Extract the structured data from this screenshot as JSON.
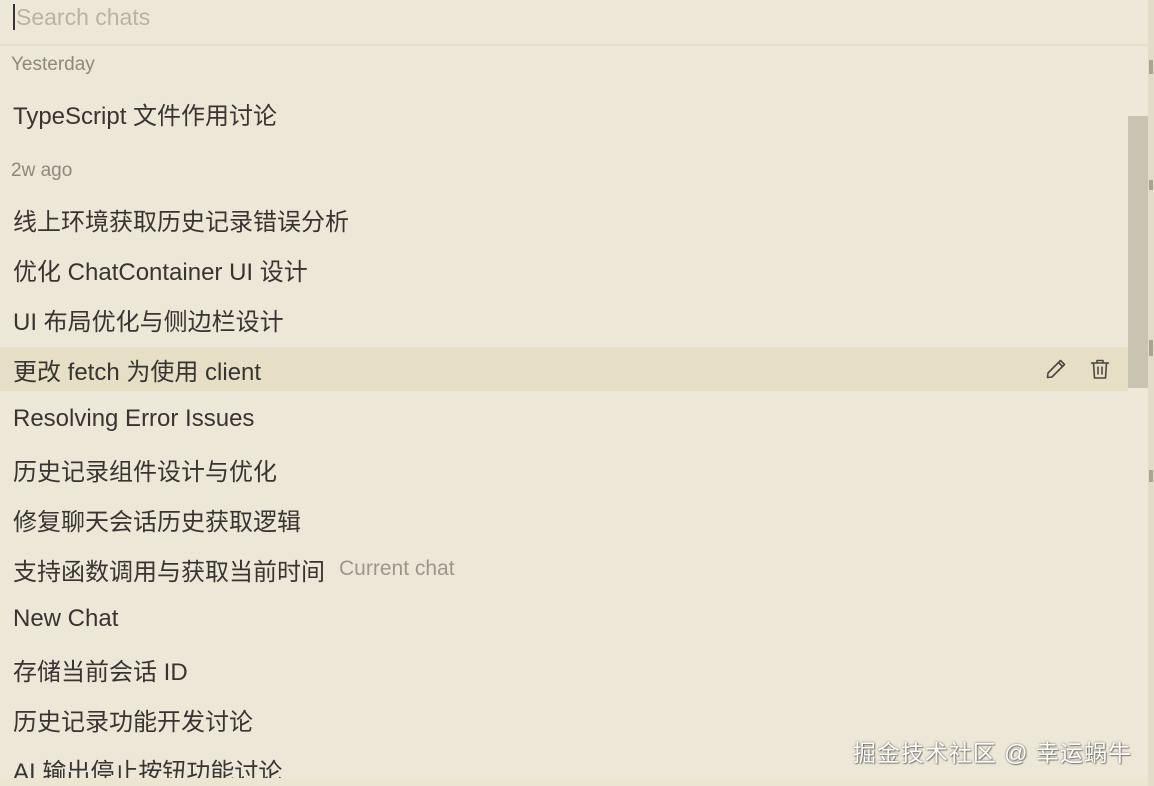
{
  "search": {
    "placeholder": "Search chats",
    "value": ""
  },
  "groups": [
    {
      "label": "Yesterday",
      "items": [
        {
          "title": "TypeScript 文件作用讨论"
        }
      ]
    },
    {
      "label": "2w ago",
      "items": [
        {
          "title": "线上环境获取历史记录错误分析"
        },
        {
          "title": "优化 ChatContainer UI 设计"
        },
        {
          "title": "UI 布局优化与侧边栏设计"
        },
        {
          "title": "更改 fetch 为使用 client",
          "hovered": true
        },
        {
          "title": "Resolving Error Issues"
        },
        {
          "title": "历史记录组件设计与优化"
        },
        {
          "title": "修复聊天会话历史获取逻辑"
        },
        {
          "title": "支持函数调用与获取当前时间",
          "tag": "Current chat"
        },
        {
          "title": "New Chat"
        },
        {
          "title": "存储当前会话 ID"
        },
        {
          "title": "历史记录功能开发讨论"
        },
        {
          "title": "AI 输出停止按钮功能讨论"
        }
      ]
    }
  ],
  "row_actions": {
    "edit_icon": "pencil-icon",
    "delete_icon": "trash-icon"
  },
  "watermark": "掘金技术社区 @ 幸运蜗牛",
  "colors": {
    "background": "#ede7d7",
    "hover_row": "#e7dfc5",
    "text": "#363532",
    "muted": "#8c887c"
  }
}
